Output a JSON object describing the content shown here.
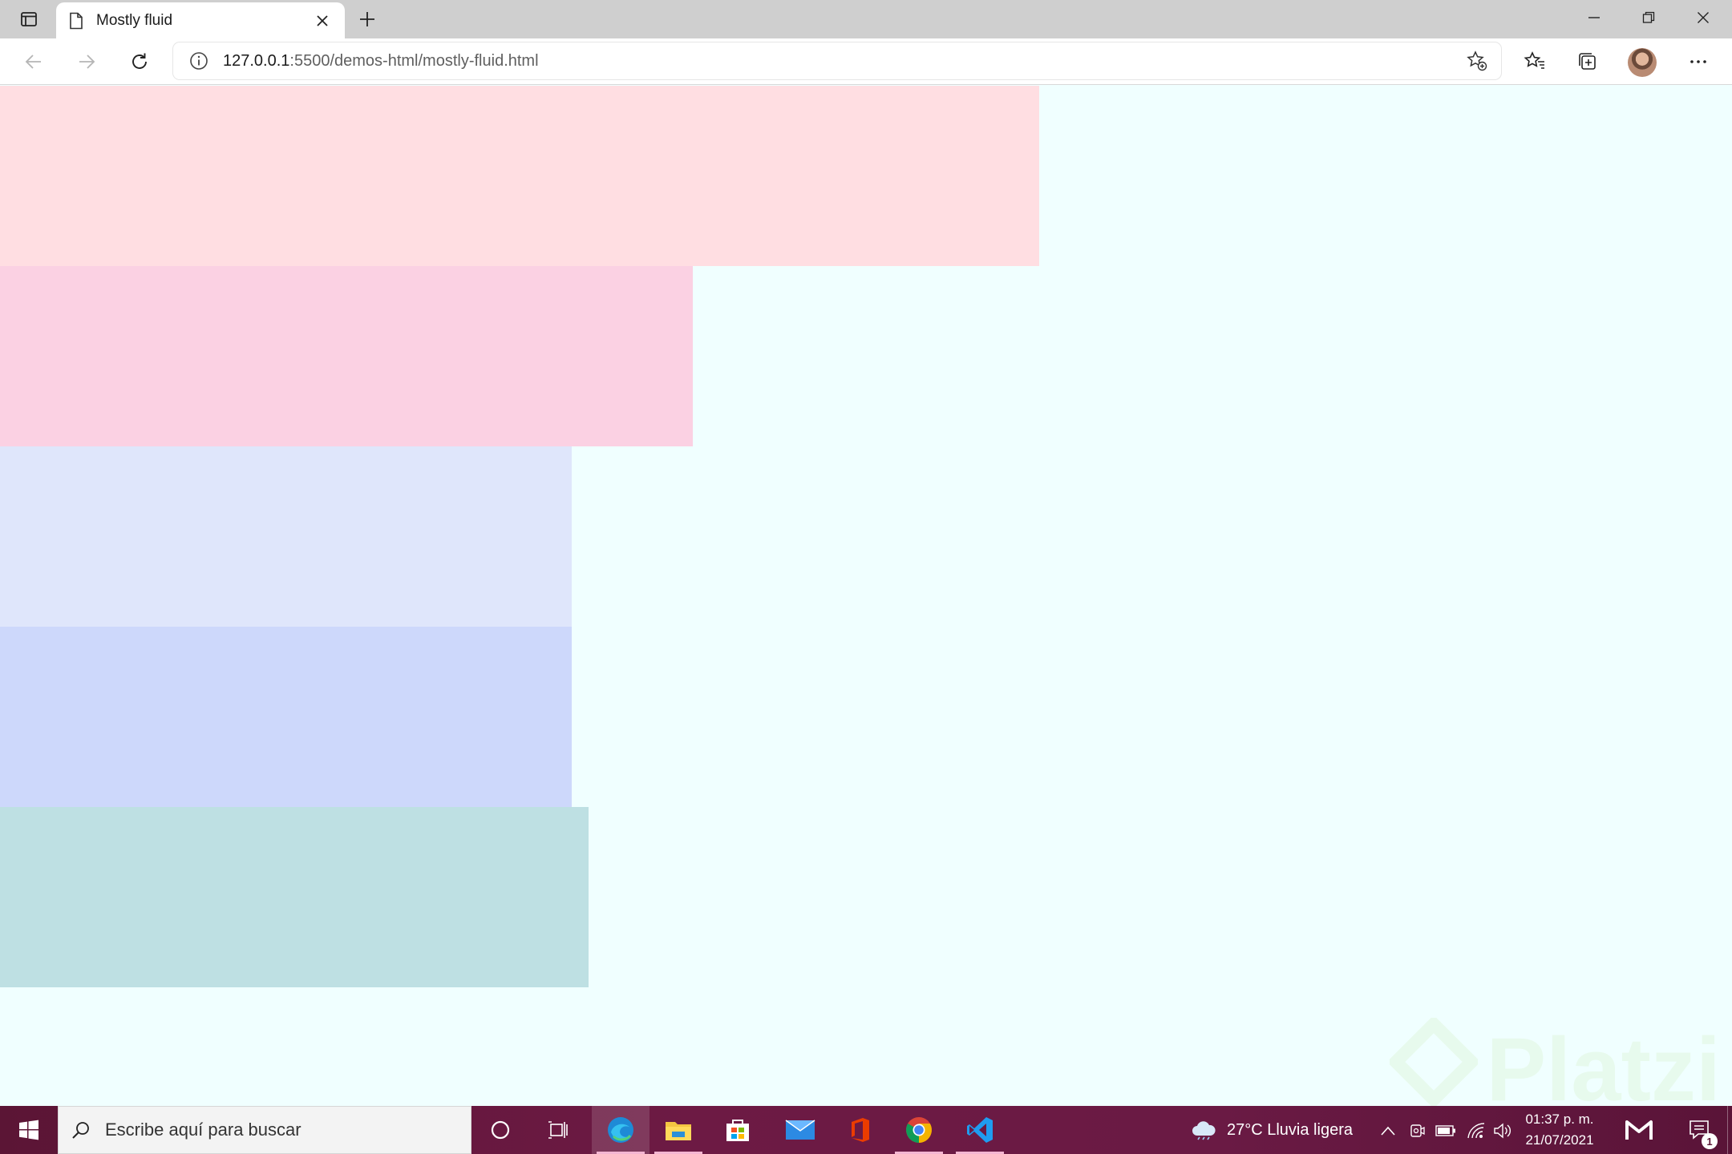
{
  "browser": {
    "tab_title": "Mostly fluid",
    "url_host": "127.0.0.1",
    "url_path": ":5500/demos-html/mostly-fluid.html"
  },
  "page": {
    "background": "#f0ffff",
    "boxes": [
      {
        "name": "box-1",
        "color": "#ffdee2"
      },
      {
        "name": "box-2",
        "color": "#fbd1e3"
      },
      {
        "name": "box-3",
        "color": "#dfe6fb"
      },
      {
        "name": "box-4",
        "color": "#cdd8fb"
      },
      {
        "name": "box-5",
        "color": "#bee0e3"
      }
    ],
    "watermark_text": "Platzi"
  },
  "taskbar": {
    "search_placeholder": "Escribe aquí para buscar",
    "apps": [
      "edge-icon",
      "file-explorer-icon",
      "store-icon",
      "mail-icon",
      "office-icon",
      "chrome-icon",
      "vscode-icon"
    ],
    "weather": "27°C  Lluvia ligera",
    "time": "01:37 p. m.",
    "date": "21/07/2021",
    "notification_count": "1"
  }
}
